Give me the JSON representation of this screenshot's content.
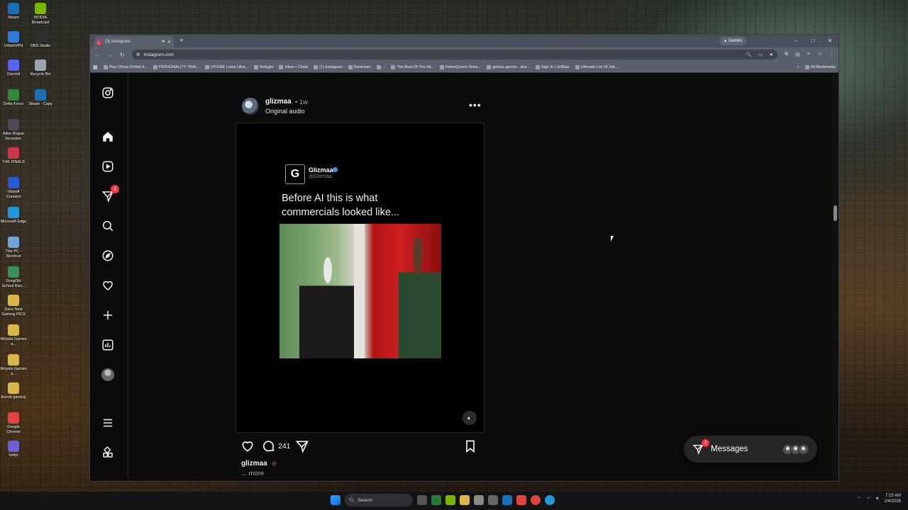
{
  "desktop": {
    "icons": [
      {
        "label": "Steam",
        "color": "#1b6fb5"
      },
      {
        "label": "NVIDIA Broadcast",
        "color": "#76b900"
      },
      {
        "label": "UrbanVPN",
        "color": "#2f7ad6"
      },
      {
        "label": "OBS Studio",
        "color": "#303030"
      },
      {
        "label": "Discord",
        "color": "#5865f2"
      },
      {
        "label": "Recycle Bin",
        "color": "#9aa6b4"
      },
      {
        "label": "Delta Force",
        "color": "#2f8a3a"
      },
      {
        "label": "Steam - Copy",
        "color": "#1b6fb5"
      },
      {
        "label": "Allen Rogue Incursion",
        "color": "#4a4a5a"
      },
      {
        "label": "THE FINALS",
        "color": "#d0364a"
      },
      {
        "label": "Ubisoft Connect",
        "color": "#2a5bd7"
      },
      {
        "label": "Microsoft Edge",
        "color": "#1f9ad6"
      },
      {
        "label": "This PC - Shortcut",
        "color": "#6aa7d8"
      },
      {
        "label": "GregOld School Run...",
        "color": "#3a8f5f"
      },
      {
        "label": "Dans New Gaming PICS",
        "color": "#d9b54a"
      },
      {
        "label": "Woyals Games a...",
        "color": "#d9b54a"
      },
      {
        "label": "Woyals Games a...",
        "color": "#d9b54a"
      },
      {
        "label": "thumb gaming",
        "color": "#d9b54a"
      },
      {
        "label": "Google Chrome",
        "color": "#e0443c"
      },
      {
        "label": "Veltyr",
        "color": "#6b5fd6"
      }
    ]
  },
  "browser": {
    "tab_title": "(3) Instagram",
    "new_tab": "+",
    "gemini_label": "Gemini",
    "url": "instagram.com",
    "bookmarks": [
      "Play Chess Online fr...",
      "PERSONALITY TRAI...",
      "VITURE Luma Ultra...",
      "fentygirl",
      "Inbox • Chats",
      "(1) Instagram",
      "Restream",
      "...",
      "The Best Of The Int...",
      "DelenQueen Strea...",
      "games games - sha...",
      "Sign In | JetBlue",
      "Ultimate List Of Jok..."
    ],
    "all_bookmarks": "All Bookmarks",
    "window_controls": {
      "minimize": "–",
      "maximize": "□",
      "close": "✕"
    }
  },
  "sidebar": {
    "notifications_badge": "3",
    "items": [
      {
        "name": "instagram-logo-icon"
      },
      {
        "name": "home-icon"
      },
      {
        "name": "reels-icon"
      },
      {
        "name": "direct-icon"
      },
      {
        "name": "search-icon"
      },
      {
        "name": "explore-icon"
      },
      {
        "name": "heart-icon"
      },
      {
        "name": "create-icon"
      },
      {
        "name": "dashboard-icon"
      },
      {
        "name": "profile-avatar"
      },
      {
        "name": "menu-icon"
      },
      {
        "name": "also-from-meta-icon"
      }
    ]
  },
  "post": {
    "username": "glizmaa",
    "time": "• 1w",
    "audio": "Original audio",
    "more": "•••",
    "tweet": {
      "logo": "G",
      "name": "Glizmaa",
      "handle": "@Glizmaa",
      "text": "Before AI this is what commercials looked like..."
    },
    "comment_count": "241",
    "caption_user": "glizmaa",
    "more_link": "... more"
  },
  "messages": {
    "label": "Messages",
    "badge": "3"
  },
  "taskbar": {
    "search_label": "Search",
    "time": "7:15 AM",
    "date": "2/4/2026"
  },
  "colors": {
    "badge": "#ff3040",
    "page_bg": "#0c0c0c",
    "chrome_bg": "#5a5f6c"
  }
}
